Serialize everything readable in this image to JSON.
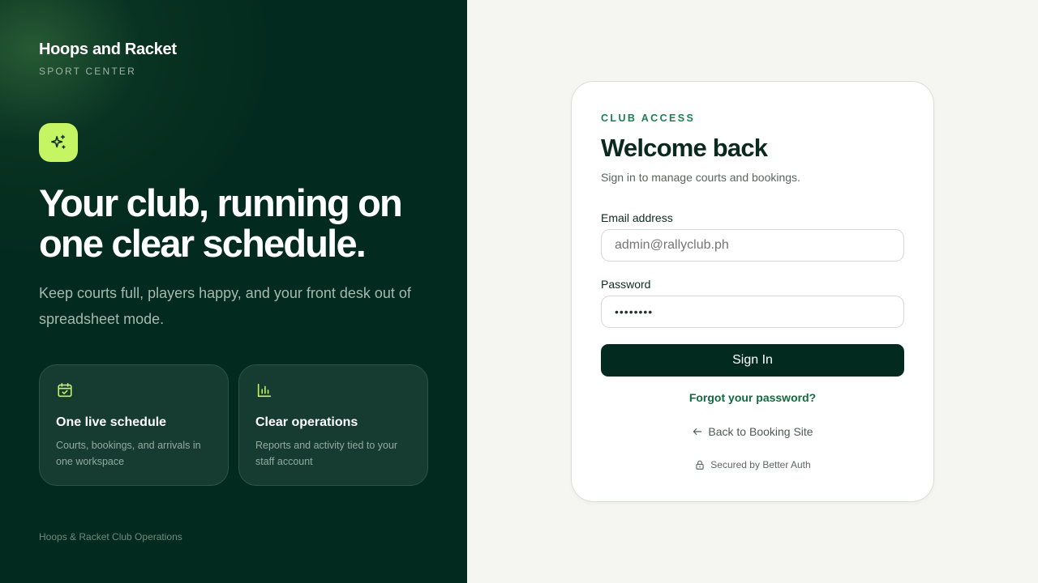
{
  "brand": {
    "title": "Hoops and Racket",
    "subtitle": "SPORT CENTER"
  },
  "hero": {
    "headline": "Your club, running on one clear schedule.",
    "subtext": "Keep courts full, players happy, and your front desk out of spreadsheet mode.",
    "icon": "sparkles-icon"
  },
  "features": [
    {
      "icon": "calendar-check-icon",
      "title": "One live schedule",
      "description": "Courts, bookings, and arrivals in one workspace"
    },
    {
      "icon": "bar-chart-icon",
      "title": "Clear operations",
      "description": "Reports and activity tied to your staff account"
    }
  ],
  "footer": {
    "text": "Hoops & Racket Club Operations"
  },
  "login": {
    "eyebrow": "CLUB ACCESS",
    "title": "Welcome back",
    "subtitle": "Sign in to manage courts and bookings.",
    "email_label": "Email address",
    "email_placeholder": "admin@rallyclub.ph",
    "password_label": "Password",
    "password_value": "••••••••",
    "submit_label": "Sign In",
    "forgot_label": "Forgot your password?",
    "back_label": "Back to Booking Site",
    "secured_label": "Secured by Better Auth"
  },
  "colors": {
    "left_panel_bg": "#032a1e",
    "accent_lime": "#c6f564",
    "accent_green": "#1e7d52",
    "page_bg": "#f5f6f1",
    "button_bg": "#032a1e"
  }
}
